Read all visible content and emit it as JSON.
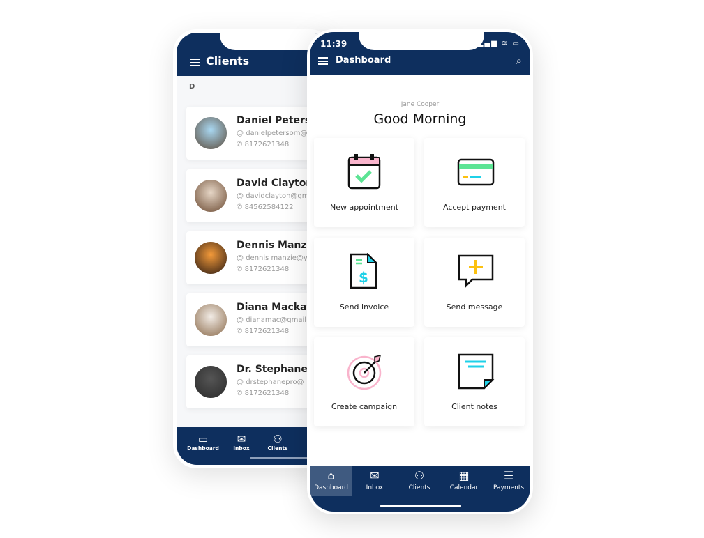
{
  "back": {
    "title": "Clients",
    "section": "D",
    "clients": [
      {
        "name": "Daniel Peterson",
        "email": "danielpetersom@",
        "phone": "8172621348"
      },
      {
        "name": "David Clayton",
        "email": "davidclayton@gm",
        "phone": "84562584122"
      },
      {
        "name": "Dennis Manzie",
        "email": "dennis manzie@y",
        "phone": "8172621348"
      },
      {
        "name": "Diana Mackay",
        "email": "dianamac@gmail",
        "phone": "8172621348"
      },
      {
        "name": "Dr. Stephane",
        "email": "drstephanepro@",
        "phone": "8172621348"
      }
    ],
    "nav": [
      {
        "label": "Dashboard",
        "icon": "devices-icon"
      },
      {
        "label": "Inbox",
        "icon": "mailbox-icon"
      },
      {
        "label": "Clients",
        "icon": "users-icon"
      }
    ]
  },
  "front": {
    "time": "11:39",
    "title": "Dashboard",
    "user": "Jane Cooper",
    "greeting": "Good Morning",
    "tiles": [
      {
        "label": "New appointment"
      },
      {
        "label": "Accept payment"
      },
      {
        "label": "Send invoice"
      },
      {
        "label": "Send message"
      },
      {
        "label": "Create campaign"
      },
      {
        "label": "Client notes"
      }
    ],
    "page_dots": 5,
    "active_dot": 0,
    "nav": [
      {
        "label": "Dashboard",
        "icon": "home-icon",
        "active": true
      },
      {
        "label": "Inbox",
        "icon": "mailbox-icon"
      },
      {
        "label": "Clients",
        "icon": "users-icon"
      },
      {
        "label": "Calendar",
        "icon": "calendar-icon"
      },
      {
        "label": "Payments",
        "icon": "coins-icon"
      }
    ]
  },
  "colors": {
    "navy": "#0e2f5e",
    "active_tab": "#3f5a80",
    "green": "#5ce494",
    "pink": "#f9b4cc",
    "cyan": "#1fd1e8",
    "yellow": "#fcc10f"
  }
}
